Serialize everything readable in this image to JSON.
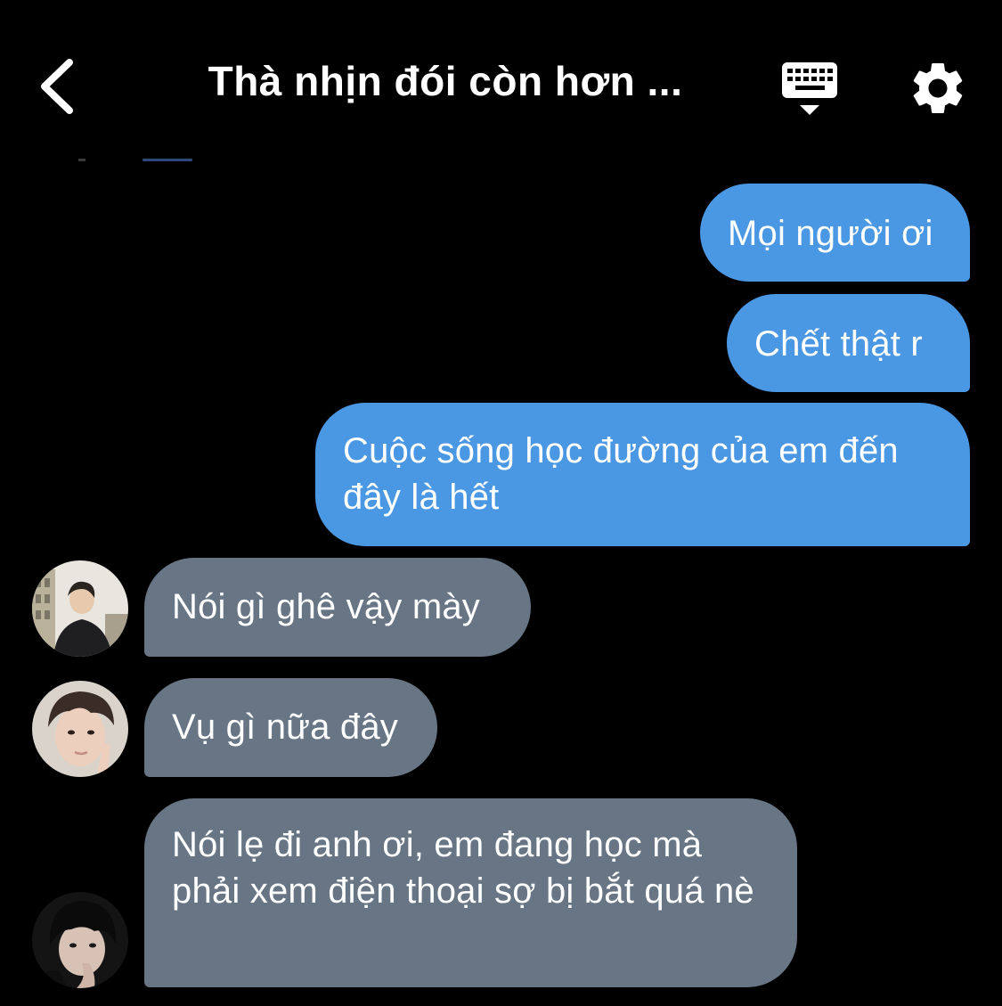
{
  "header": {
    "title": "Thà nhịn đói còn hơn ...",
    "back_icon": "chevron-left-icon",
    "keyboard_icon": "keyboard-hide-icon",
    "settings_icon": "gear-icon"
  },
  "colors": {
    "outgoing_bubble": "#4a97e4",
    "incoming_bubble": "#677584",
    "background": "#000000"
  },
  "messages": [
    {
      "direction": "outgoing",
      "text": "Mọi người ơi"
    },
    {
      "direction": "outgoing",
      "text": "Chết thật r"
    },
    {
      "direction": "outgoing",
      "text": "Cuộc sống học đường của em đến đây là hết"
    },
    {
      "direction": "incoming",
      "text": "Nói gì ghê vậy mày"
    },
    {
      "direction": "incoming",
      "text": "Vụ gì nữa đây"
    },
    {
      "direction": "incoming",
      "text": "Nói lẹ đi anh ơi, em đang học mà phải xem điện thoại sợ bị bắt quá nè"
    }
  ]
}
